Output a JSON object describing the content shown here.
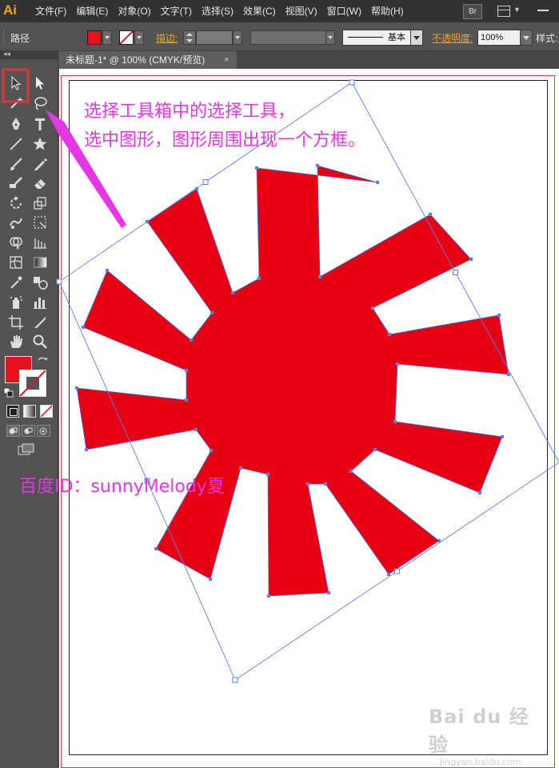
{
  "app": {
    "logo": "Ai"
  },
  "menubar": {
    "items": [
      "文件(F)",
      "编辑(E)",
      "对象(O)",
      "文字(T)",
      "选择(S)",
      "效果(C)",
      "视图(V)",
      "窗口(W)",
      "帮助(H)"
    ],
    "bridge_label": "Br"
  },
  "control_bar": {
    "selection_type": "路径",
    "fill_color": "#e8121e",
    "stroke_label": "描边:",
    "brush_label": "基本",
    "opacity_label": "不透明度:",
    "opacity_value": "100%",
    "style_label": "样式:"
  },
  "document": {
    "tab_title": "未标题-1* @ 100% (CMYK/预览)",
    "close_glyph": "×"
  },
  "toolbox": {
    "collapse_glyph": "◂◂",
    "tools": [
      "selection-tool",
      "direct-selection-tool",
      "magic-wand-tool",
      "lasso-tool",
      "pen-tool",
      "type-tool",
      "line-segment-tool",
      "star-tool",
      "paintbrush-tool",
      "pencil-tool",
      "blob-brush-tool",
      "eraser-tool",
      "rotate-tool",
      "scale-tool",
      "warp-tool",
      "free-transform-tool",
      "shape-builder-tool",
      "perspective-grid-tool",
      "mesh-tool",
      "gradient-tool",
      "eyedropper-tool",
      "blend-tool",
      "symbol-sprayer-tool",
      "column-graph-tool",
      "artboard-tool",
      "slice-tool",
      "hand-tool",
      "zoom-tool"
    ],
    "fill_swatch_color": "#e8121e",
    "highlight_color": "#e8322e"
  },
  "annotation": {
    "line1": "选择工具箱中的选择工具，",
    "line2": "选中图形，图形周围出现一个方框。",
    "credit": "百度ID：sunnyMelody夏",
    "color": "#e636e6"
  },
  "artwork": {
    "shape": "starburst",
    "points": 18,
    "fill": "#e60012",
    "selection_color": "#5a7ff0"
  },
  "watermark": {
    "main": "Bai du 经验",
    "sub": "jingyan.baidu.com"
  }
}
